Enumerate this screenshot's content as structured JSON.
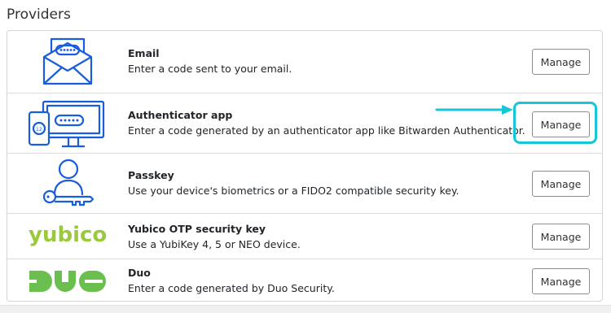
{
  "page": {
    "title": "Providers"
  },
  "providers": [
    {
      "name": "Email",
      "description": "Enter a code sent to your email.",
      "button_label": "Manage",
      "icon": "email-envelope-icon"
    },
    {
      "name": "Authenticator app",
      "description": "Enter a code generated by an authenticator app like Bitwarden Authenticator.",
      "button_label": "Manage",
      "icon": "authenticator-devices-icon"
    },
    {
      "name": "Passkey",
      "description": "Use your device's biometrics or a FIDO2 compatible security key.",
      "button_label": "Manage",
      "icon": "user-key-icon"
    },
    {
      "name": "Yubico OTP security key",
      "description": "Use a YubiKey 4, 5 or NEO device.",
      "button_label": "Manage",
      "icon": "yubico-logo",
      "logo_text": "yubico"
    },
    {
      "name": "Duo",
      "description": "Enter a code generated by Duo Security.",
      "button_label": "Manage",
      "icon": "duo-logo"
    }
  ],
  "annotation": {
    "highlight_color": "#17c5d8"
  },
  "colors": {
    "icon_blue": "#175ddc",
    "yubico_green": "#9aca3c",
    "duo_green": "#6bbf4e"
  }
}
